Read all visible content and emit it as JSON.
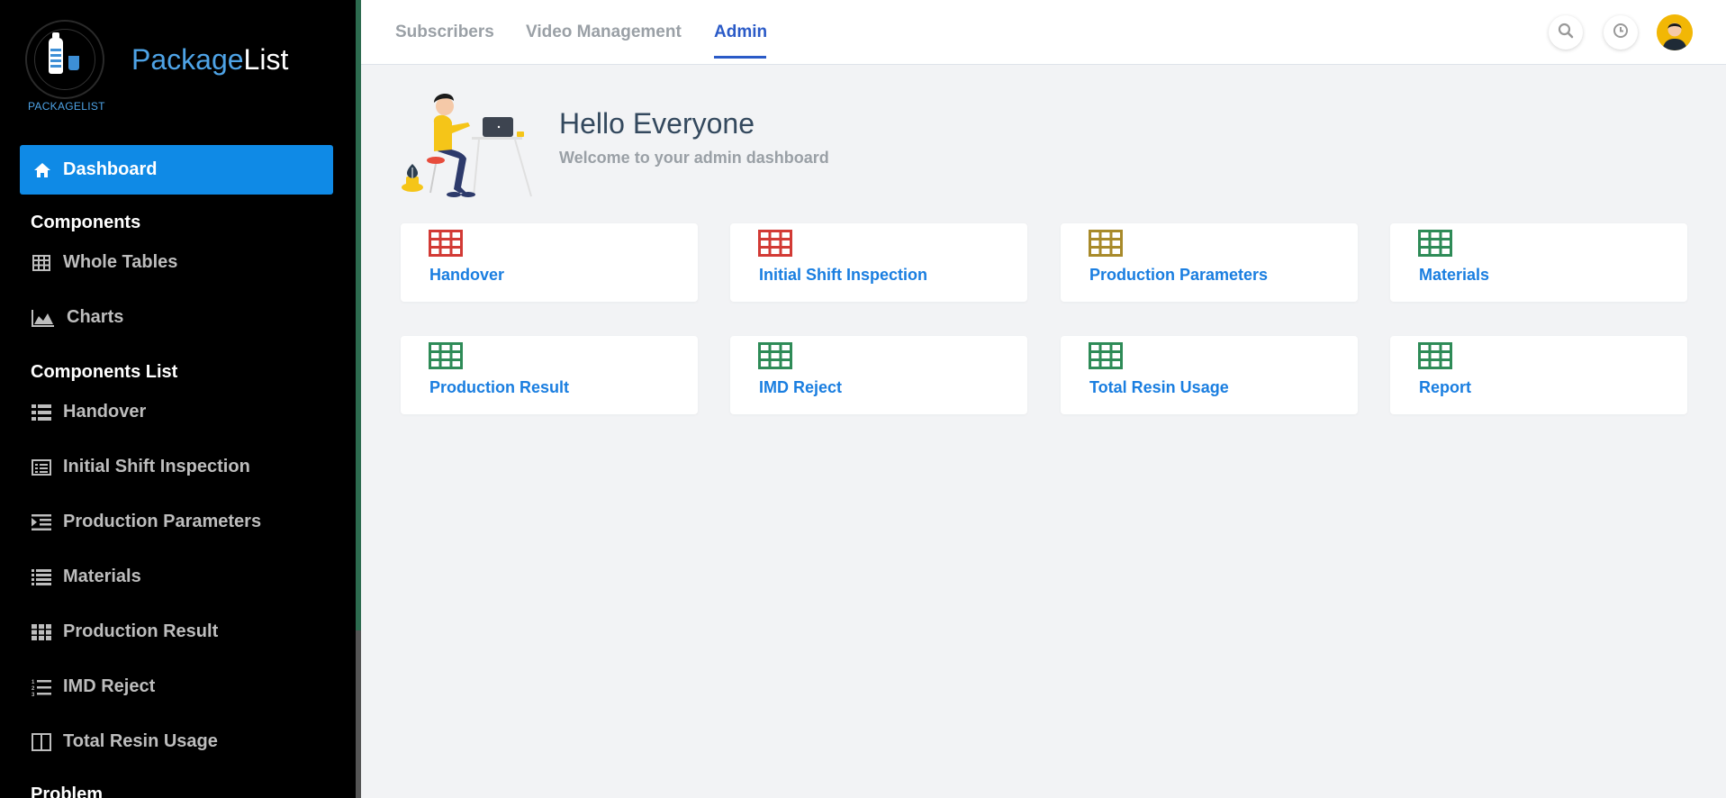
{
  "brand": {
    "logo_text": "PACKAGELIST",
    "name_part1": "Package",
    "name_part2": "List"
  },
  "sidebar": {
    "active_item": {
      "label": "Dashboard",
      "icon": "home-icon"
    },
    "section1_title": "Components",
    "section1_items": [
      {
        "label": "Whole Tables",
        "icon": "table-icon"
      },
      {
        "label": "Charts",
        "icon": "area-chart-icon"
      }
    ],
    "section2_title": "Components List",
    "section2_items": [
      {
        "label": "Handover",
        "icon": "th-list-icon"
      },
      {
        "label": "Initial Shift Inspection",
        "icon": "list-alt-icon"
      },
      {
        "label": "Production Parameters",
        "icon": "indent-icon"
      },
      {
        "label": "Materials",
        "icon": "list-icon"
      },
      {
        "label": "Production Result",
        "icon": "th-icon"
      },
      {
        "label": "IMD Reject",
        "icon": "list-ol-icon"
      },
      {
        "label": "Total Resin Usage",
        "icon": "columns-icon"
      }
    ],
    "section3_title": "Problem"
  },
  "topbar": {
    "tabs": [
      "Subscribers",
      "Video Management",
      "Admin"
    ],
    "active_tab": "Admin"
  },
  "hero": {
    "title": "Hello Everyone",
    "subtitle": "Welcome to your admin dashboard"
  },
  "cards": [
    {
      "label": "Handover",
      "color": "#d23a35"
    },
    {
      "label": "Initial Shift Inspection",
      "color": "#d23a35"
    },
    {
      "label": "Production Parameters",
      "color": "#a88a2a"
    },
    {
      "label": "Materials",
      "color": "#2e8b57"
    },
    {
      "label": "Production Result",
      "color": "#2e8b57"
    },
    {
      "label": "IMD Reject",
      "color": "#2e8b57"
    },
    {
      "label": "Total Resin Usage",
      "color": "#2e8b57"
    },
    {
      "label": "Report",
      "color": "#2e8b57"
    }
  ],
  "colors": {
    "accent": "#0f8ae6",
    "active_tab": "#2a5ac7",
    "card_link": "#1a7ee0"
  }
}
